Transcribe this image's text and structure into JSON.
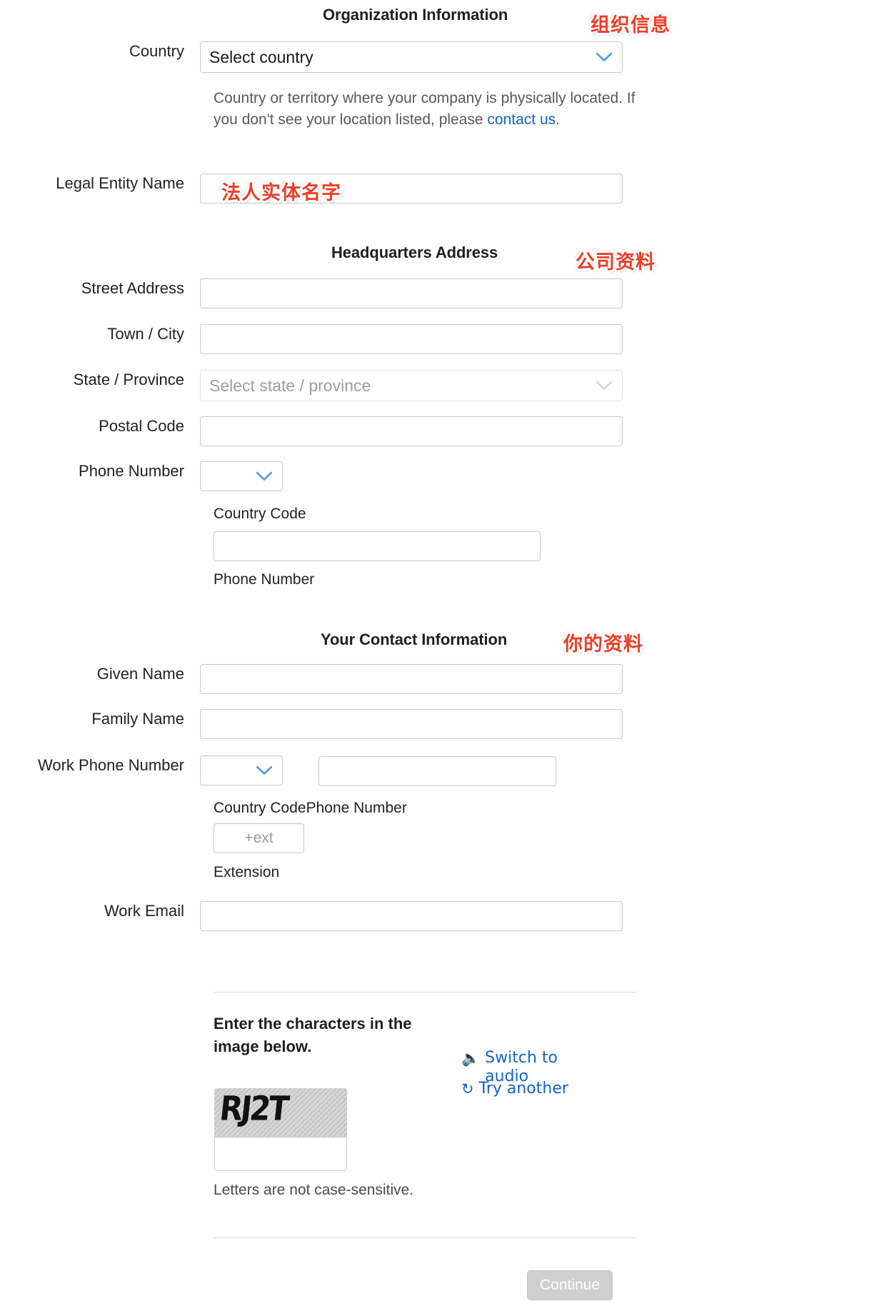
{
  "sections": {
    "org": {
      "heading": "Organization Information",
      "annotation": "组织信息"
    },
    "hq": {
      "heading": "Headquarters Address",
      "annotation": "公司资料"
    },
    "contact": {
      "heading": "Your Contact Information",
      "annotation": "你的资料"
    }
  },
  "fields": {
    "country": {
      "label": "Country",
      "value": "Select country",
      "help_before": "Country or territory where your company is physically located. If you don't see your location listed, please ",
      "help_link": "contact us",
      "help_after": "."
    },
    "legal_entity": {
      "label": "Legal Entity Name",
      "value": "",
      "annotation": "法人实体名字"
    },
    "street": {
      "label": "Street Address",
      "value": ""
    },
    "city": {
      "label": "Town / City",
      "value": ""
    },
    "state": {
      "label": "State / Province",
      "value": "Select state / province"
    },
    "postal": {
      "label": "Postal Code",
      "value": ""
    },
    "phone": {
      "label": "Phone Number",
      "country_code_value": "",
      "country_code_sublabel": "Country Code",
      "number_value": "",
      "number_sublabel": "Phone Number"
    },
    "given_name": {
      "label": "Given Name",
      "value": ""
    },
    "family_name": {
      "label": "Family Name",
      "value": ""
    },
    "work_phone": {
      "label": "Work Phone Number",
      "country_code_value": "",
      "country_code_sublabel": "Country Code",
      "number_value": "",
      "number_sublabel": "Phone Number",
      "ext_placeholder": "+ext",
      "ext_value": "",
      "ext_sublabel": "Extension"
    },
    "work_email": {
      "label": "Work Email",
      "value": ""
    }
  },
  "captcha": {
    "prompt": "Enter the characters in the image below.",
    "image_text": "RJ2T",
    "input_value": "",
    "note": "Letters are not case-sensitive.",
    "switch_audio": "Switch to audio",
    "try_another": "Try another",
    "audio_icon": "speaker-icon",
    "refresh_icon": "refresh-icon"
  },
  "footer": {
    "continue_label": "Continue"
  },
  "colors": {
    "link": "#1565c0",
    "annotation": "#e8402a",
    "chevron": "#5b9bd5",
    "border": "#c9c9c9"
  }
}
